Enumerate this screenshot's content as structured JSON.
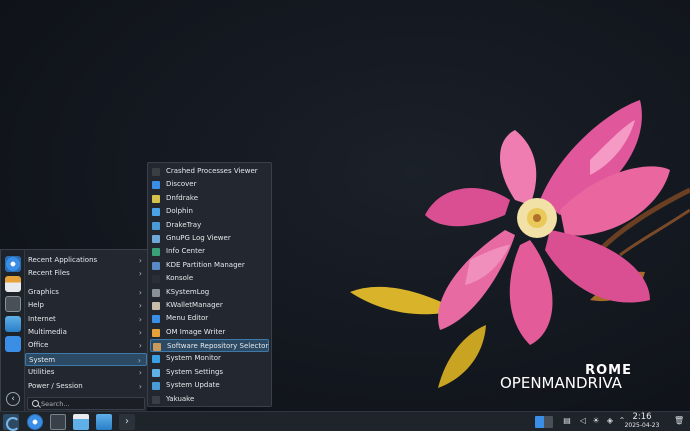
{
  "brand": {
    "version": "ROME",
    "name": "OPENMANDRIVA"
  },
  "launcher": {
    "categories": [
      {
        "label": "Recent Applications"
      },
      {
        "label": "Recent Files"
      },
      {
        "label": "Graphics"
      },
      {
        "label": "Help"
      },
      {
        "label": "Internet"
      },
      {
        "label": "Multimedia"
      },
      {
        "label": "Office"
      },
      {
        "label": "System",
        "active": true
      },
      {
        "label": "Utilities"
      },
      {
        "label": "Power / Session"
      }
    ],
    "search_placeholder": "Search..."
  },
  "system_submenu": {
    "items": [
      {
        "label": "Crashed Processes Viewer",
        "icon": "bug-icon",
        "color": "#3a3f46"
      },
      {
        "label": "Discover",
        "icon": "discover-icon",
        "color": "#3a8ee6"
      },
      {
        "label": "Dnfdrake",
        "icon": "package-icon",
        "color": "#d6c24a"
      },
      {
        "label": "Dolphin",
        "icon": "folder-icon",
        "color": "#4aa3e6"
      },
      {
        "label": "DrakeTray",
        "icon": "tray-icon",
        "color": "#4a9ad6"
      },
      {
        "label": "GnuPG Log Viewer",
        "icon": "log-icon",
        "color": "#6fa8d6"
      },
      {
        "label": "Info Center",
        "icon": "info-icon",
        "color": "#3aa07a"
      },
      {
        "label": "KDE Partition Manager",
        "icon": "partition-icon",
        "color": "#5a8ac6"
      },
      {
        "label": "Konsole",
        "icon": "terminal-icon",
        "color": "#2a2f36"
      },
      {
        "label": "KSystemLog",
        "icon": "system-log-icon",
        "color": "#8a9099"
      },
      {
        "label": "KWalletManager",
        "icon": "wallet-icon",
        "color": "#c7bda8"
      },
      {
        "label": "Menu Editor",
        "icon": "menu-editor-icon",
        "color": "#3a8ee6"
      },
      {
        "label": "OM Image Writer",
        "icon": "image-writer-icon",
        "color": "#e6a23a"
      },
      {
        "label": "Software Repository Selector",
        "icon": "repository-icon",
        "color": "#c99a5a",
        "active": true
      },
      {
        "label": "System Monitor",
        "icon": "monitor-icon",
        "color": "#3aa0e6"
      },
      {
        "label": "System Settings",
        "icon": "settings-icon",
        "color": "#5fb0e8"
      },
      {
        "label": "System Update",
        "icon": "update-icon",
        "color": "#4a9ad6"
      },
      {
        "label": "Yakuake",
        "icon": "dropdown-terminal-icon",
        "color": "#3a3f46"
      }
    ]
  },
  "taskbar": {
    "clock_time": "2:16",
    "clock_date": "2025-04-23"
  }
}
